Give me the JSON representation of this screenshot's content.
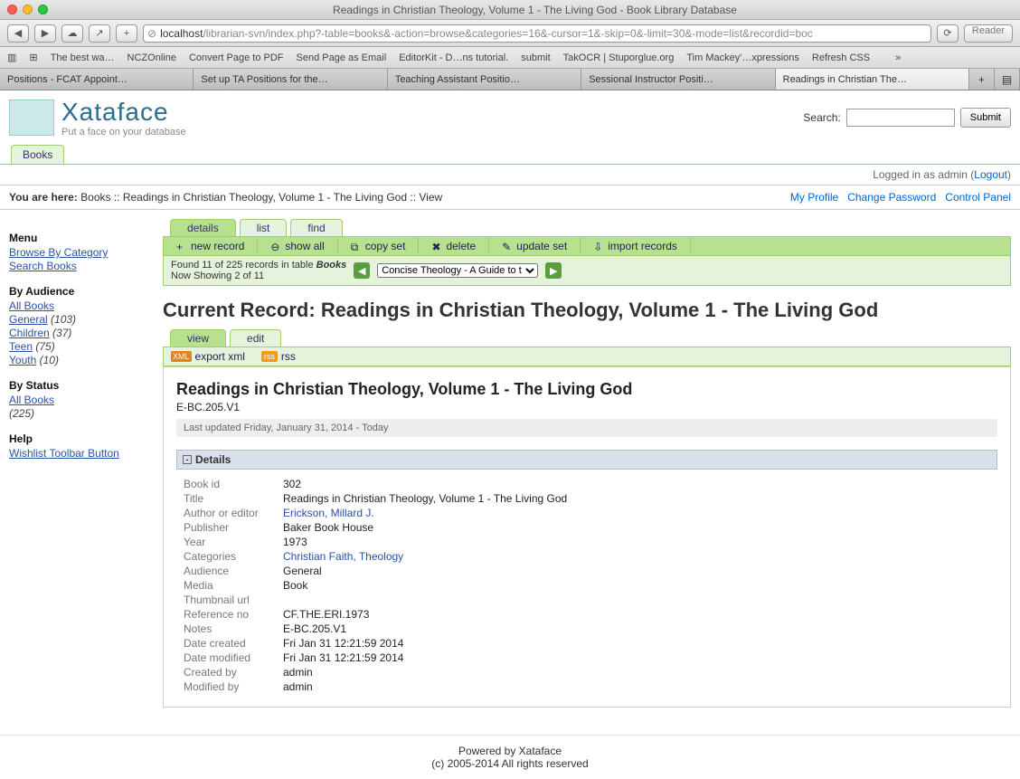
{
  "window_title": "Readings in Christian Theology, Volume 1 - The Living God - Book Library Database",
  "url_host": "localhost",
  "url_path": "/librarian-svn/index.php?-table=books&-action=browse&categories=16&-cursor=1&-skip=0&-limit=30&-mode=list&recordid=boc",
  "reader_label": "Reader",
  "bookmarks": [
    "The best wa…",
    "NCZOnline",
    "Convert Page to PDF",
    "Send Page as Email",
    "EditorKit - D…ns tutorial.",
    "submit",
    "TakOCR | Stuporglue.org",
    "Tim Mackey'…xpressions",
    "Refresh CSS"
  ],
  "tabs": [
    {
      "label": "Positions - FCAT Appoint…"
    },
    {
      "label": "Set up TA Positions for the…"
    },
    {
      "label": "Teaching Assistant Positio…"
    },
    {
      "label": "Sessional Instructor Positi…"
    },
    {
      "label": "Readings in Christian The…",
      "active": true
    }
  ],
  "logo": {
    "main": "Xataface",
    "sub": "Put a face on your database"
  },
  "search": {
    "label": "Search:",
    "button": "Submit"
  },
  "app_tab": "Books",
  "login_text": "Logged in as admin (",
  "logout": "Logout",
  "breadcrumb": {
    "prefix": "You are here:",
    "path": "Books :: Readings in Christian Theology, Volume 1 - The Living God :: View"
  },
  "profile_links": [
    "My Profile",
    "Change Password",
    "Control Panel"
  ],
  "sidebar": {
    "menu_h": "Menu",
    "browse": "Browse By Category",
    "search": "Search Books",
    "aud_h": "By Audience",
    "aud": [
      {
        "label": "All Books"
      },
      {
        "label": "General",
        "count": "(103)"
      },
      {
        "label": "Children",
        "count": "(37)"
      },
      {
        "label": "Teen",
        "count": "(75)"
      },
      {
        "label": "Youth",
        "count": "(10)"
      }
    ],
    "stat_h": "By Status",
    "stat": [
      {
        "label": "All Books"
      },
      {
        "label": "",
        "count": "(225)"
      }
    ],
    "help_h": "Help",
    "wishlist": "Wishlist Toolbar Button"
  },
  "sub_tabs": [
    "details",
    "list",
    "find"
  ],
  "actions": [
    {
      "icon": "+",
      "label": "new record"
    },
    {
      "icon": "⊖",
      "label": "show all"
    },
    {
      "icon": "⧉",
      "label": "copy set"
    },
    {
      "icon": "✖",
      "label": "delete"
    },
    {
      "icon": "✎",
      "label": "update set"
    },
    {
      "icon": "⇩",
      "label": "import records"
    }
  ],
  "found": {
    "l1": "Found 11 of 225 records in table ",
    "tbl": "Books",
    "l2": "Now Showing 2 of 11"
  },
  "record_selector": "Concise Theology - A Guide to t",
  "current_prefix": "Current Record:",
  "current_title": "Readings in Christian Theology, Volume 1 - The Living God",
  "view_tabs": [
    "view",
    "edit"
  ],
  "exports": [
    {
      "ic": "XML",
      "label": "export xml"
    },
    {
      "ic": "rss",
      "label": "rss"
    }
  ],
  "record": {
    "title": "Readings in Christian Theology, Volume 1 - The Living God",
    "code": "E-BC.205.V1",
    "updated": "Last updated Friday, January 31, 2014 - Today"
  },
  "details_hdr": "Details",
  "details": [
    {
      "lab": "Book id",
      "val": "302"
    },
    {
      "lab": "Title",
      "val": "Readings in Christian Theology, Volume 1 - The Living God"
    },
    {
      "lab": "Author or editor",
      "val": "Erickson, Millard J.",
      "link": true
    },
    {
      "lab": "Publisher",
      "val": "Baker Book House"
    },
    {
      "lab": "Year",
      "val": "1973"
    },
    {
      "lab": "Categories",
      "val": "Christian Faith, Theology",
      "link": true
    },
    {
      "lab": "Audience",
      "val": "General"
    },
    {
      "lab": "Media",
      "val": "Book"
    },
    {
      "lab": "Thumbnail url",
      "val": ""
    },
    {
      "lab": "Reference no",
      "val": "CF.THE.ERI.1973"
    },
    {
      "lab": "Notes",
      "val": "E-BC.205.V1"
    },
    {
      "lab": "Date created",
      "val": "Fri Jan 31 12:21:59 2014"
    },
    {
      "lab": "Date modified",
      "val": "Fri Jan 31 12:21:59 2014"
    },
    {
      "lab": "Created by",
      "val": "admin"
    },
    {
      "lab": "Modified by",
      "val": "admin"
    }
  ],
  "footer": {
    "l1": "Powered by Xataface",
    "l2": "(c) 2005-2014 All rights reserved"
  }
}
